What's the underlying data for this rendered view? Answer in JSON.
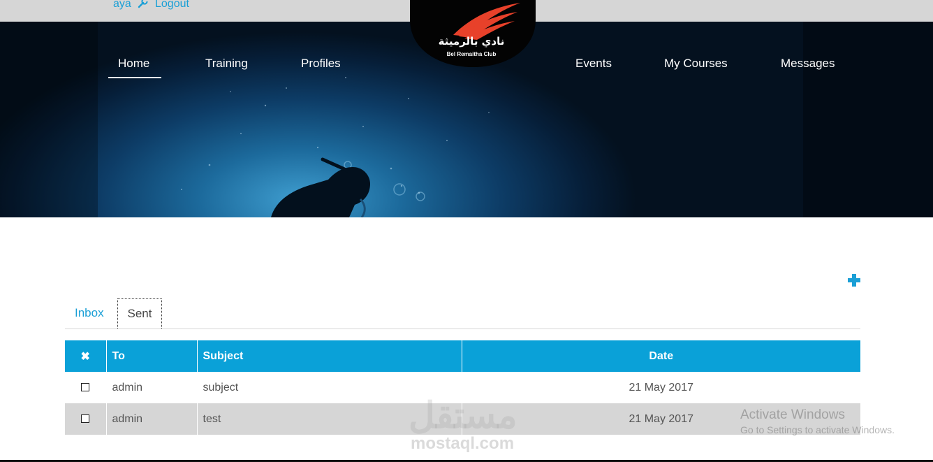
{
  "user": {
    "name": "aya",
    "logout_label": "Logout"
  },
  "nav": {
    "left": [
      "Home",
      "Training",
      "Profiles"
    ],
    "right": [
      "Events",
      "My Courses",
      "Messages"
    ],
    "active": "Home"
  },
  "logo": {
    "arabic": "نادي بالرميثة",
    "english": "Bel Remaitha Club"
  },
  "tabs": {
    "inbox": "Inbox",
    "sent": "Sent",
    "active": "Sent"
  },
  "table": {
    "headers": {
      "delete": "✖",
      "to": "To",
      "subject": "Subject",
      "date": "Date"
    },
    "rows": [
      {
        "to": "admin",
        "subject": "subject",
        "date": "21 May 2017"
      },
      {
        "to": "admin",
        "subject": "test",
        "date": "21 May 2017"
      }
    ]
  },
  "watermark": {
    "arabic": "مستقل",
    "text": "mostaql.com"
  },
  "activation": {
    "title": "Activate Windows",
    "subtitle": "Go to Settings to activate Windows."
  },
  "colors": {
    "accent": "#0aa1d8",
    "link": "#1a9fd6",
    "logo_flame": "#e8412a"
  }
}
